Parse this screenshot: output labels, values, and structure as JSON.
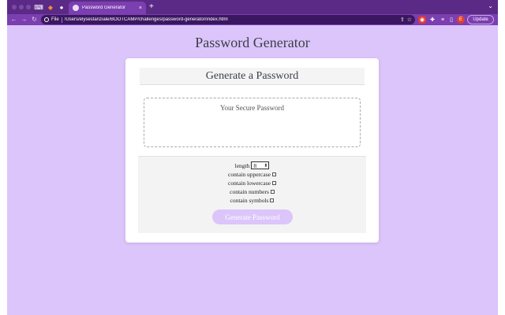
{
  "browser": {
    "active_tab_title": "Password Generator",
    "tab_close": "×",
    "new_tab": "+",
    "tab_menu": "⌄",
    "file_chip": "File",
    "url": "/Users/elysestanziale/BOOTCAMP/challenges/password-generator/index.html",
    "profile_initial": "E",
    "update_label": "Update",
    "share_icon": "⇪",
    "star_icon": "☆",
    "back_icon": "←",
    "forward_icon": "→",
    "reload_icon": "↻"
  },
  "page": {
    "title": "Password Generator",
    "card_header": "Generate a Password",
    "password_placeholder": "Your Secure Password",
    "length_label": "length",
    "length_value": "8",
    "options": [
      {
        "label": "contain uppercase"
      },
      {
        "label": "contain lowercase"
      },
      {
        "label": "contain numbers"
      },
      {
        "label": "contain symbols"
      }
    ],
    "generate_button": "Generate Password"
  },
  "colors": {
    "page_background": "#dcc5fb",
    "chrome_purple": "#7b3fb0",
    "tab_strip": "#5b2a86",
    "button_bg": "#dcc5fb"
  }
}
